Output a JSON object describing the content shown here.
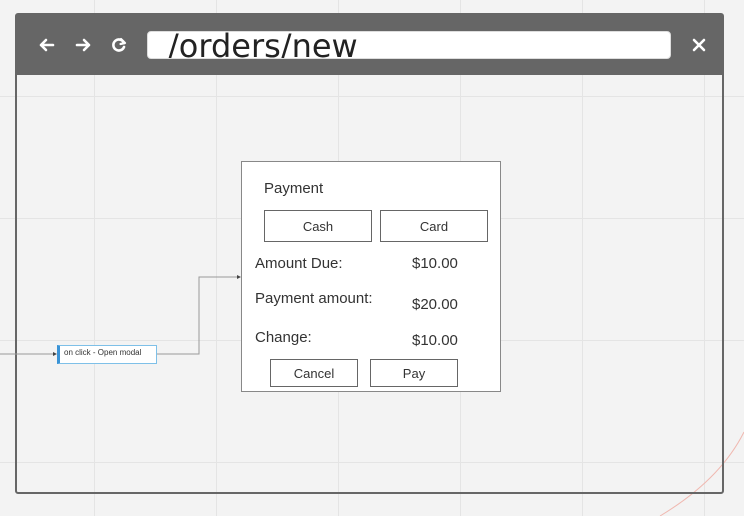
{
  "browser": {
    "url": "/orders/new",
    "icons": {
      "back": "arrow-left-icon",
      "forward": "arrow-right-icon",
      "reload": "reload-icon",
      "close": "close-icon"
    }
  },
  "annotation": {
    "note": "on click - Open modal"
  },
  "modal": {
    "title": "Payment",
    "methods": {
      "cash_label": "Cash",
      "card_label": "Card"
    },
    "rows": [
      {
        "label": "Amount Due:",
        "value": "$10.00"
      },
      {
        "label": "Payment amount:",
        "value": "$20.00"
      },
      {
        "label": "Change:",
        "value": "$10.00"
      }
    ],
    "actions": {
      "cancel_label": "Cancel",
      "pay_label": "Pay"
    }
  },
  "colors": {
    "titlebar": "#666666",
    "canvas": "#f3f3f3",
    "note_accent": "#3a93d6"
  }
}
